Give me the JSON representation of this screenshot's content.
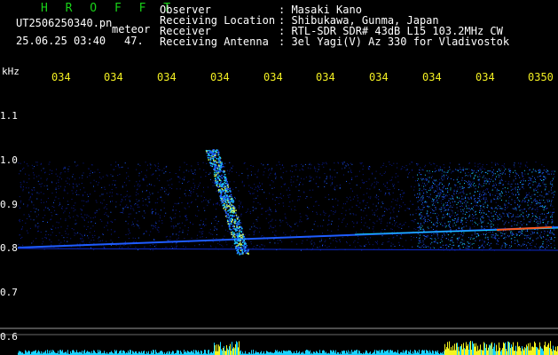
{
  "header": {
    "title": "H R O F F T",
    "filename": "UT2506250340.pn",
    "meteor_label": "meteor",
    "datetime": "25.06.25 03:40",
    "count": "47."
  },
  "info": [
    {
      "label": "Observer",
      "value": ": Masaki Kano"
    },
    {
      "label": "Receiving Location",
      "value": ": Shibukawa, Gunma, Japan"
    },
    {
      "label": "Receiver",
      "value": ": RTL-SDR SDR# 43dB L15 103.2MHz CW"
    },
    {
      "label": "Receiving Antenna",
      "value": ": 3el Yagi(V) Az 330 for Vladivostok"
    }
  ],
  "time_axis": {
    "labels": [
      "034",
      "034",
      "034",
      "034",
      "034",
      "034",
      "034",
      "034",
      "034",
      "0350"
    ]
  },
  "freq_axis": {
    "unit": "kHz",
    "labels": [
      "1.1",
      "1.0",
      "0.9",
      "0.8",
      "0.7",
      "0.6"
    ]
  },
  "colors": {
    "background": "#000000",
    "title_green": "#19d219",
    "tick_yellow": "#f2ef22",
    "signal_blue": "#1e5cff",
    "signal_cyan": "#19d2ff",
    "noise_blue": "#0b1a8c",
    "bar_yellow": "#f5f51e"
  }
}
